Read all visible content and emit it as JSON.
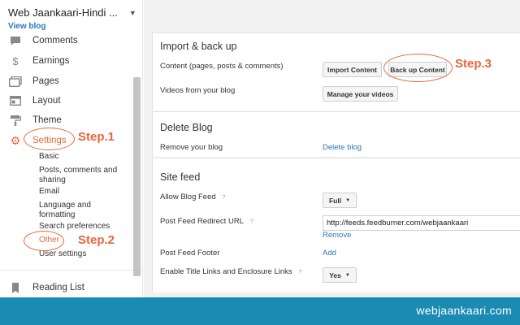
{
  "sidebar": {
    "blog_title": "Web Jaankaari-Hindi ...",
    "view_blog": "View blog",
    "items": [
      {
        "label": "Comments",
        "icon": "comment-icon"
      },
      {
        "label": "Earnings",
        "icon": "dollar-icon"
      },
      {
        "label": "Pages",
        "icon": "pages-icon"
      },
      {
        "label": "Layout",
        "icon": "layout-icon"
      },
      {
        "label": "Theme",
        "icon": "paint-roller-icon"
      },
      {
        "label": "Settings",
        "icon": "gear-icon"
      }
    ],
    "sub_items": [
      "Basic",
      "Posts, comments and sharing",
      "Email",
      "Language and formatting",
      "Search preferences",
      "Other",
      "User settings"
    ],
    "reading_list": "Reading List"
  },
  "annotations": {
    "step1": "Step.1",
    "step2": "Step.2",
    "step3": "Step.3",
    "color": "#e8663b"
  },
  "import_backup": {
    "title": "Import & back up",
    "content_label": "Content (pages, posts & comments)",
    "import_button": "Import Content",
    "backup_button": "Back up Content",
    "videos_label": "Videos from your blog",
    "manage_videos_button": "Manage your videos"
  },
  "delete_blog": {
    "title": "Delete Blog",
    "remove_label": "Remove your blog",
    "delete_link": "Delete blog"
  },
  "site_feed": {
    "title": "Site feed",
    "allow_feed_label": "Allow Blog Feed",
    "allow_feed_value": "Full",
    "redirect_label": "Post Feed Redirect URL",
    "redirect_value": "http://feeds.feedburner.com/webjaankaari",
    "remove_link": "Remove",
    "footer_label": "Post Feed Footer",
    "add_link": "Add",
    "title_links_label": "Enable Title Links and Enclosure Links",
    "title_links_value": "Yes",
    "help_glyph": "?"
  },
  "footer": {
    "brand": "webjaankaari.com",
    "color": "#1a8bb3"
  }
}
